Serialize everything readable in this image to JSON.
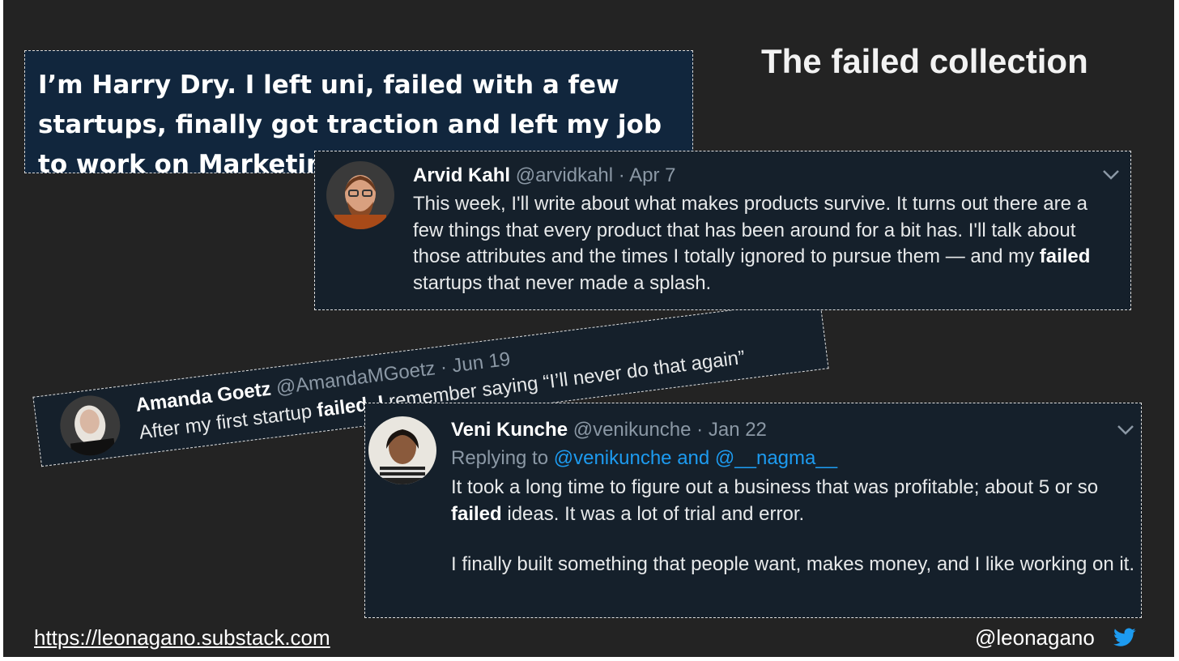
{
  "slide": {
    "title": "The failed collection",
    "quote": "I’m Harry Dry. I left uni, failed with a few startups, finally got traction and left my job to work on Marketing Examples.",
    "footer_link": "https://leonagano.substack.com",
    "footer_handle": "@leonagano",
    "footer_icon": "twitter-bird-icon"
  },
  "tweets": [
    {
      "name": "Arvid Kahl",
      "handle": "@arvidkahl",
      "separator": "·",
      "date": "Apr 7",
      "body_parts": [
        "This week, I'll write about what makes products survive. It turns out there are a few things that every product that has been around for a bit has. I'll talk about those attributes and the times I totally ignored to pursue them — and my ",
        "failed",
        " startups that never made a splash."
      ]
    },
    {
      "name": "Amanda Goetz",
      "handle": "@AmandaMGoetz",
      "separator": "·",
      "date": "Jun 19",
      "body_parts": [
        "After my first startup ",
        "failed",
        ", ",
        "I",
        " remember saying “I’ll never do that again”"
      ]
    },
    {
      "name": "Veni Kunche",
      "handle": "@venikunche",
      "separator": "·",
      "date": "Jan 22",
      "reply_prefix": "Replying to",
      "reply_mentions": "@venikunche and @__nagma__",
      "body_parts": [
        "It took a long time to figure out a business that was profitable; about 5 or so ",
        "failed",
        " ideas. It was a lot of trial and error."
      ],
      "body_para2": "I finally built something that people want, makes money, and I like working on it."
    }
  ],
  "colors": {
    "slide_bg": "#232323",
    "tweet_bg": "#15202b",
    "quote_bg": "#11263d",
    "muted": "#8b98a5",
    "link": "#1d9bf0"
  }
}
